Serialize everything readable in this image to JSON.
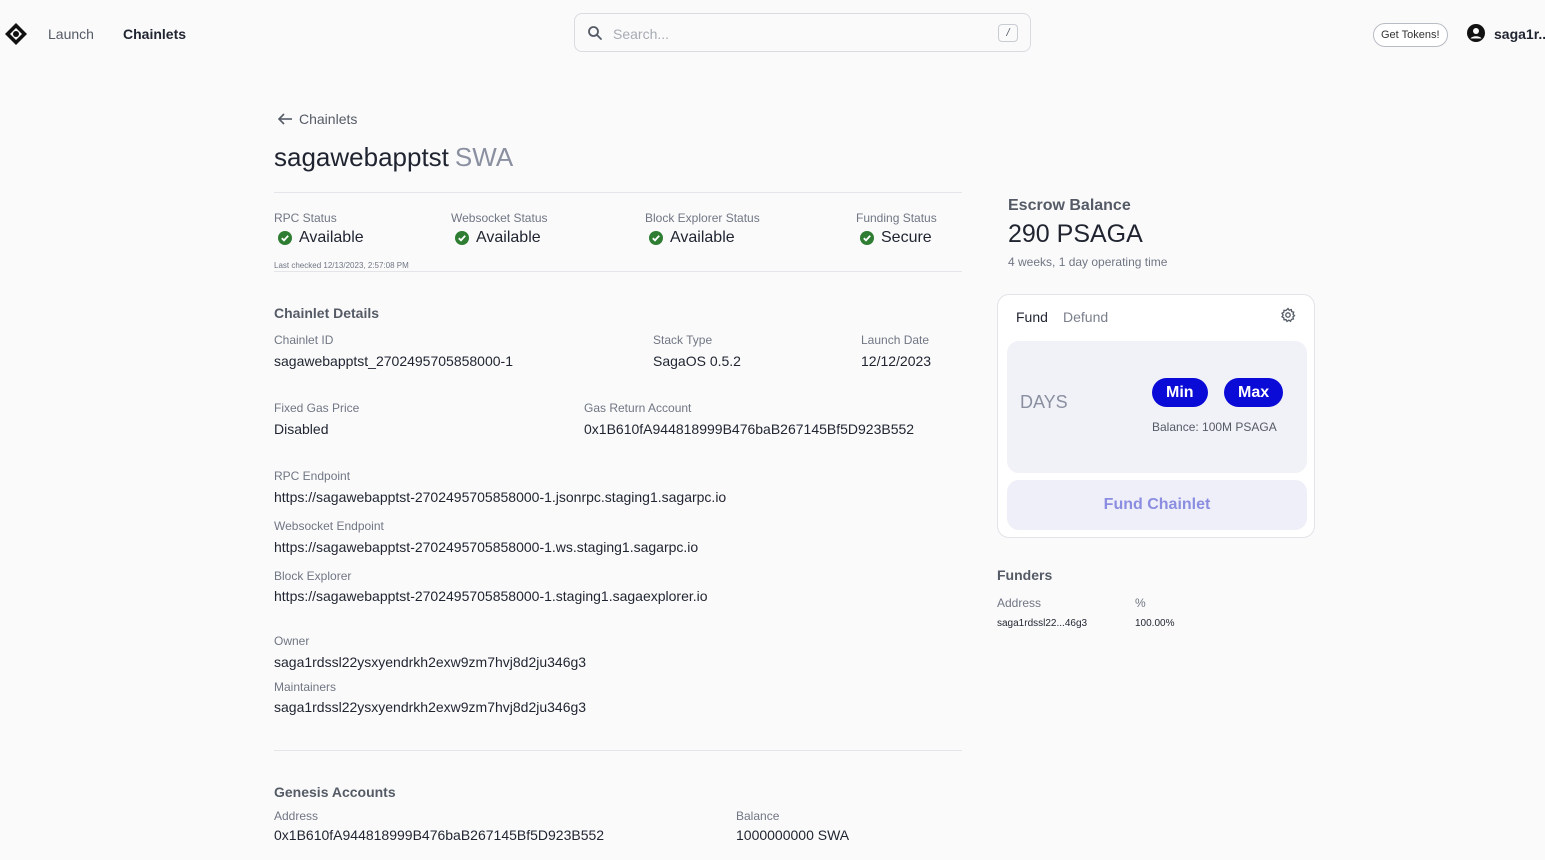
{
  "nav": {
    "launch": "Launch",
    "chainlets": "Chainlets",
    "get_tokens": "Get Tokens!",
    "user_name": "saga1r.."
  },
  "search": {
    "placeholder": "Search...",
    "shortcut": "/"
  },
  "breadcrumb": {
    "back_label": "Chainlets"
  },
  "chainlet": {
    "name": "sagawebapptst",
    "ticker": "SWA"
  },
  "statuses": [
    {
      "label": "RPC Status",
      "value": "Available"
    },
    {
      "label": "Websocket Status",
      "value": "Available"
    },
    {
      "label": "Block Explorer Status",
      "value": "Available"
    },
    {
      "label": "Funding Status",
      "value": "Secure"
    }
  ],
  "last_checked": "Last checked 12/13/2023, 2:57:08 PM",
  "details": {
    "section_title": "Chainlet Details",
    "chainlet_id_label": "Chainlet ID",
    "chainlet_id": "sagawebapptst_2702495705858000-1",
    "stack_type_label": "Stack Type",
    "stack_type": "SagaOS 0.5.2",
    "launch_date_label": "Launch Date",
    "launch_date": "12/12/2023",
    "fixed_gas_label": "Fixed Gas Price",
    "fixed_gas": "Disabled",
    "gas_return_label": "Gas Return Account",
    "gas_return": "0x1B610fA944818999B476baB267145Bf5D923B552",
    "rpc_endpoint_label": "RPC Endpoint",
    "rpc_endpoint": "https://sagawebapptst-2702495705858000-1.jsonrpc.staging1.sagarpc.io",
    "ws_endpoint_label": "Websocket Endpoint",
    "ws_endpoint": "https://sagawebapptst-2702495705858000-1.ws.staging1.sagarpc.io",
    "block_explorer_label": "Block Explorer",
    "block_explorer": "https://sagawebapptst-2702495705858000-1.staging1.sagaexplorer.io",
    "owner_label": "Owner",
    "owner": "saga1rdssl22ysxyendrkh2exw9zm7hvj8d2ju346g3",
    "maintainers_label": "Maintainers",
    "maintainers": "saga1rdssl22ysxyendrkh2exw9zm7hvj8d2ju346g3"
  },
  "genesis": {
    "section_title": "Genesis Accounts",
    "address_label": "Address",
    "balance_label": "Balance",
    "rows": [
      {
        "address": "0x1B610fA944818999B476baB267145Bf5D923B552",
        "balance": "1000000000 SWA"
      }
    ]
  },
  "escrow": {
    "title": "Escrow Balance",
    "value": "290 PSAGA",
    "subtitle": "4 weeks, 1 day operating time"
  },
  "fund_card": {
    "tab_fund": "Fund",
    "tab_defund": "Defund",
    "days_placeholder": "DAYS",
    "min_label": "Min",
    "max_label": "Max",
    "balance_note": "Balance: 100M PSAGA",
    "fund_button": "Fund Chainlet"
  },
  "funders": {
    "title": "Funders",
    "address_label": "Address",
    "percent_label": "%",
    "rows": [
      {
        "address": "saga1rdssl22...46g3",
        "percent": "100.00%"
      }
    ]
  },
  "colors": {
    "accent_blue": "#0b0bd8",
    "status_green": "#2e7d32",
    "background": "#fafafa"
  }
}
